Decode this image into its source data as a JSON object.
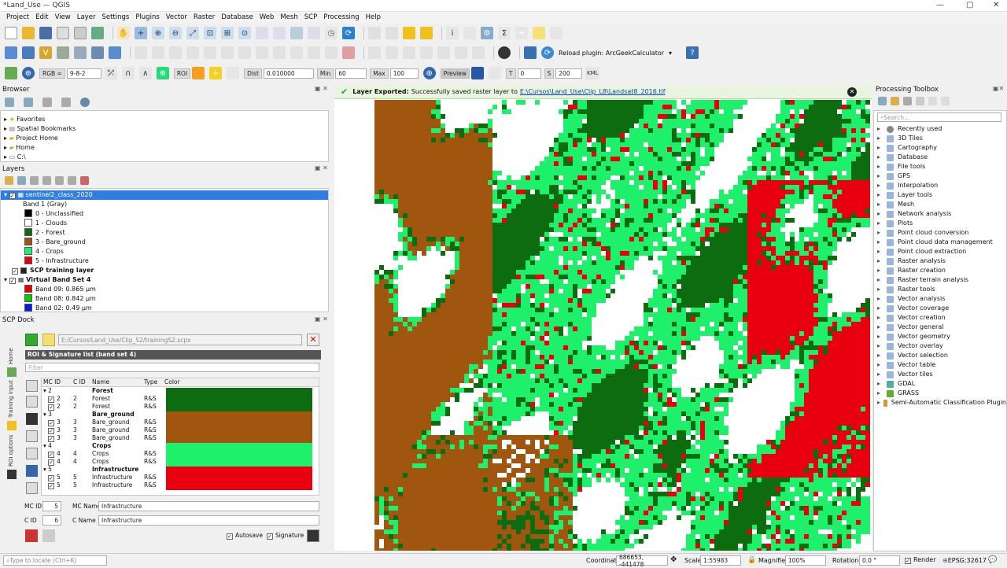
{
  "window": {
    "title": "*Land_Use — QGIS",
    "min": "—",
    "max": "▢",
    "close": "✕"
  },
  "menu": [
    "Project",
    "Edit",
    "View",
    "Layer",
    "Settings",
    "Plugins",
    "Vector",
    "Raster",
    "Database",
    "Web",
    "Mesh",
    "SCP",
    "Processing",
    "Help"
  ],
  "toolbar2": {
    "reload_label": "Reload plugin: ArcGeekCalculator"
  },
  "scp_toolbar": {
    "rgb_label": "RGB =",
    "rgb_value": "9-8-2",
    "roi_label": "ROI",
    "dist_label": "Dist",
    "dist_value": "0.010000",
    "min_label": "Min",
    "min_value": "60",
    "max_label": "Max",
    "max_value": "100",
    "preview_label": "Preview",
    "t_value": "0",
    "s_label": "S",
    "s_value": "200",
    "kml_label": "KML"
  },
  "browser": {
    "title": "Browser",
    "items": [
      "Favorites",
      "Spatial Bookmarks",
      "Project Home",
      "Home",
      "C:\\"
    ]
  },
  "layers": {
    "title": "Layers",
    "selected_layer": "sentinel2_class_2020",
    "band_label": "Band 1 (Gray)",
    "classes": [
      {
        "label": "0 - Unclassified",
        "color": "#000000"
      },
      {
        "label": "1 - Clouds",
        "color": "#ffffff"
      },
      {
        "label": "2 - Forest",
        "color": "#0d6b10"
      },
      {
        "label": "3 - Bare_ground",
        "color": "#a0560f"
      },
      {
        "label": "4 - Crops",
        "color": "#1ff06c"
      },
      {
        "label": "5 - Infrastructure",
        "color": "#e8000f"
      }
    ],
    "scp_training": "SCP training layer",
    "virtual_band": "Virtual Band Set 4",
    "bands": [
      {
        "label": "Band 09: 0.865 µm",
        "color": "#e00000"
      },
      {
        "label": "Band 08: 0.842 µm",
        "color": "#00d000"
      },
      {
        "label": "Band 02: 0.49 µm",
        "color": "#0020e0"
      }
    ]
  },
  "scp": {
    "title": "SCP Dock",
    "file_path": "E:/Cursos/Land_Use/Clip_S2/trainingS2.scpx",
    "list_title": "ROI & Signature list (band set 4)",
    "filter_placeholder": "Filter",
    "vtabs": [
      "Home",
      "Training input",
      "ROI options"
    ],
    "headers": {
      "mcid": "MC ID",
      "cid": "C ID",
      "name": "Name",
      "type": "Type",
      "color": "Color"
    },
    "rows": [
      {
        "mc": "2",
        "c": "",
        "name": "Forest",
        "type": "",
        "group": true
      },
      {
        "mc": "2",
        "c": "2",
        "name": "Forest",
        "type": "R&S",
        "group": false
      },
      {
        "mc": "2",
        "c": "2",
        "name": "Forest",
        "type": "R&S",
        "group": false
      },
      {
        "mc": "3",
        "c": "",
        "name": "Bare_ground",
        "type": "",
        "group": true
      },
      {
        "mc": "3",
        "c": "3",
        "name": "Bare_ground",
        "type": "R&S",
        "group": false
      },
      {
        "mc": "3",
        "c": "3",
        "name": "Bare_ground",
        "type": "R&S",
        "group": false
      },
      {
        "mc": "3",
        "c": "3",
        "name": "Bare_ground",
        "type": "R&S",
        "group": false
      },
      {
        "mc": "4",
        "c": "",
        "name": "Crops",
        "type": "",
        "group": true
      },
      {
        "mc": "4",
        "c": "4",
        "name": "Crops",
        "type": "R&S",
        "group": false
      },
      {
        "mc": "4",
        "c": "4",
        "name": "Crops",
        "type": "R&S",
        "group": false
      },
      {
        "mc": "5",
        "c": "",
        "name": "Infrastructure",
        "type": "",
        "group": true
      },
      {
        "mc": "5",
        "c": "5",
        "name": "Infrastructure",
        "type": "R&S",
        "group": false
      },
      {
        "mc": "5",
        "c": "5",
        "name": "Infrastructure",
        "type": "R&S",
        "group": false
      }
    ],
    "color_blocks": [
      "#0d6b10",
      "#a0560f",
      "#1ff06c",
      "#e8000f"
    ],
    "mc_id_label": "MC ID",
    "mc_id_value": "5",
    "mc_name_label": "MC Name",
    "mc_name_value": "Infrastructure",
    "c_id_label": "C ID",
    "c_id_value": "6",
    "c_name_label": "C Name",
    "c_name_value": "Infrastructure",
    "autosave_label": "Autosave",
    "signature_label": "Signature"
  },
  "message": {
    "bold": "Layer Exported:",
    "text": "Successfully saved raster layer to",
    "link": "E:\\Cursos\\Land_Use\\Clip_L8\\Landsat8_2016.tif"
  },
  "toolbox": {
    "title": "Processing Toolbox",
    "search_placeholder": "Search...",
    "items": [
      "Recently used",
      "3D Tiles",
      "Cartography",
      "Database",
      "File tools",
      "GPS",
      "Interpolation",
      "Layer tools",
      "Mesh",
      "Network analysis",
      "Plots",
      "Point cloud conversion",
      "Point cloud data management",
      "Point cloud extraction",
      "Raster analysis",
      "Raster creation",
      "Raster terrain analysis",
      "Raster tools",
      "Vector analysis",
      "Vector coverage",
      "Vector creation",
      "Vector general",
      "Vector geometry",
      "Vector overlay",
      "Vector selection",
      "Vector table",
      "Vector tiles",
      "GDAL",
      "GRASS",
      "Semi-Automatic Classification Plugin"
    ]
  },
  "status": {
    "locate_placeholder": "Type to locate (Ctrl+K)",
    "coordinate_label": "Coordinate",
    "coordinate_value": "686653, -441478",
    "scale_label": "Scale",
    "scale_value": "1:55983",
    "magnifier_label": "Magnifier",
    "magnifier_value": "100%",
    "rotation_label": "Rotation",
    "rotation_value": "0.0 °",
    "render_label": "Render",
    "epsg": "EPSG:32617"
  },
  "colors": {
    "forest": "#0d6b10",
    "bare": "#a0560f",
    "crops": "#1ff06c",
    "infra": "#e8000f",
    "clouds": "#ffffff",
    "selection": "#2f7ee0"
  }
}
